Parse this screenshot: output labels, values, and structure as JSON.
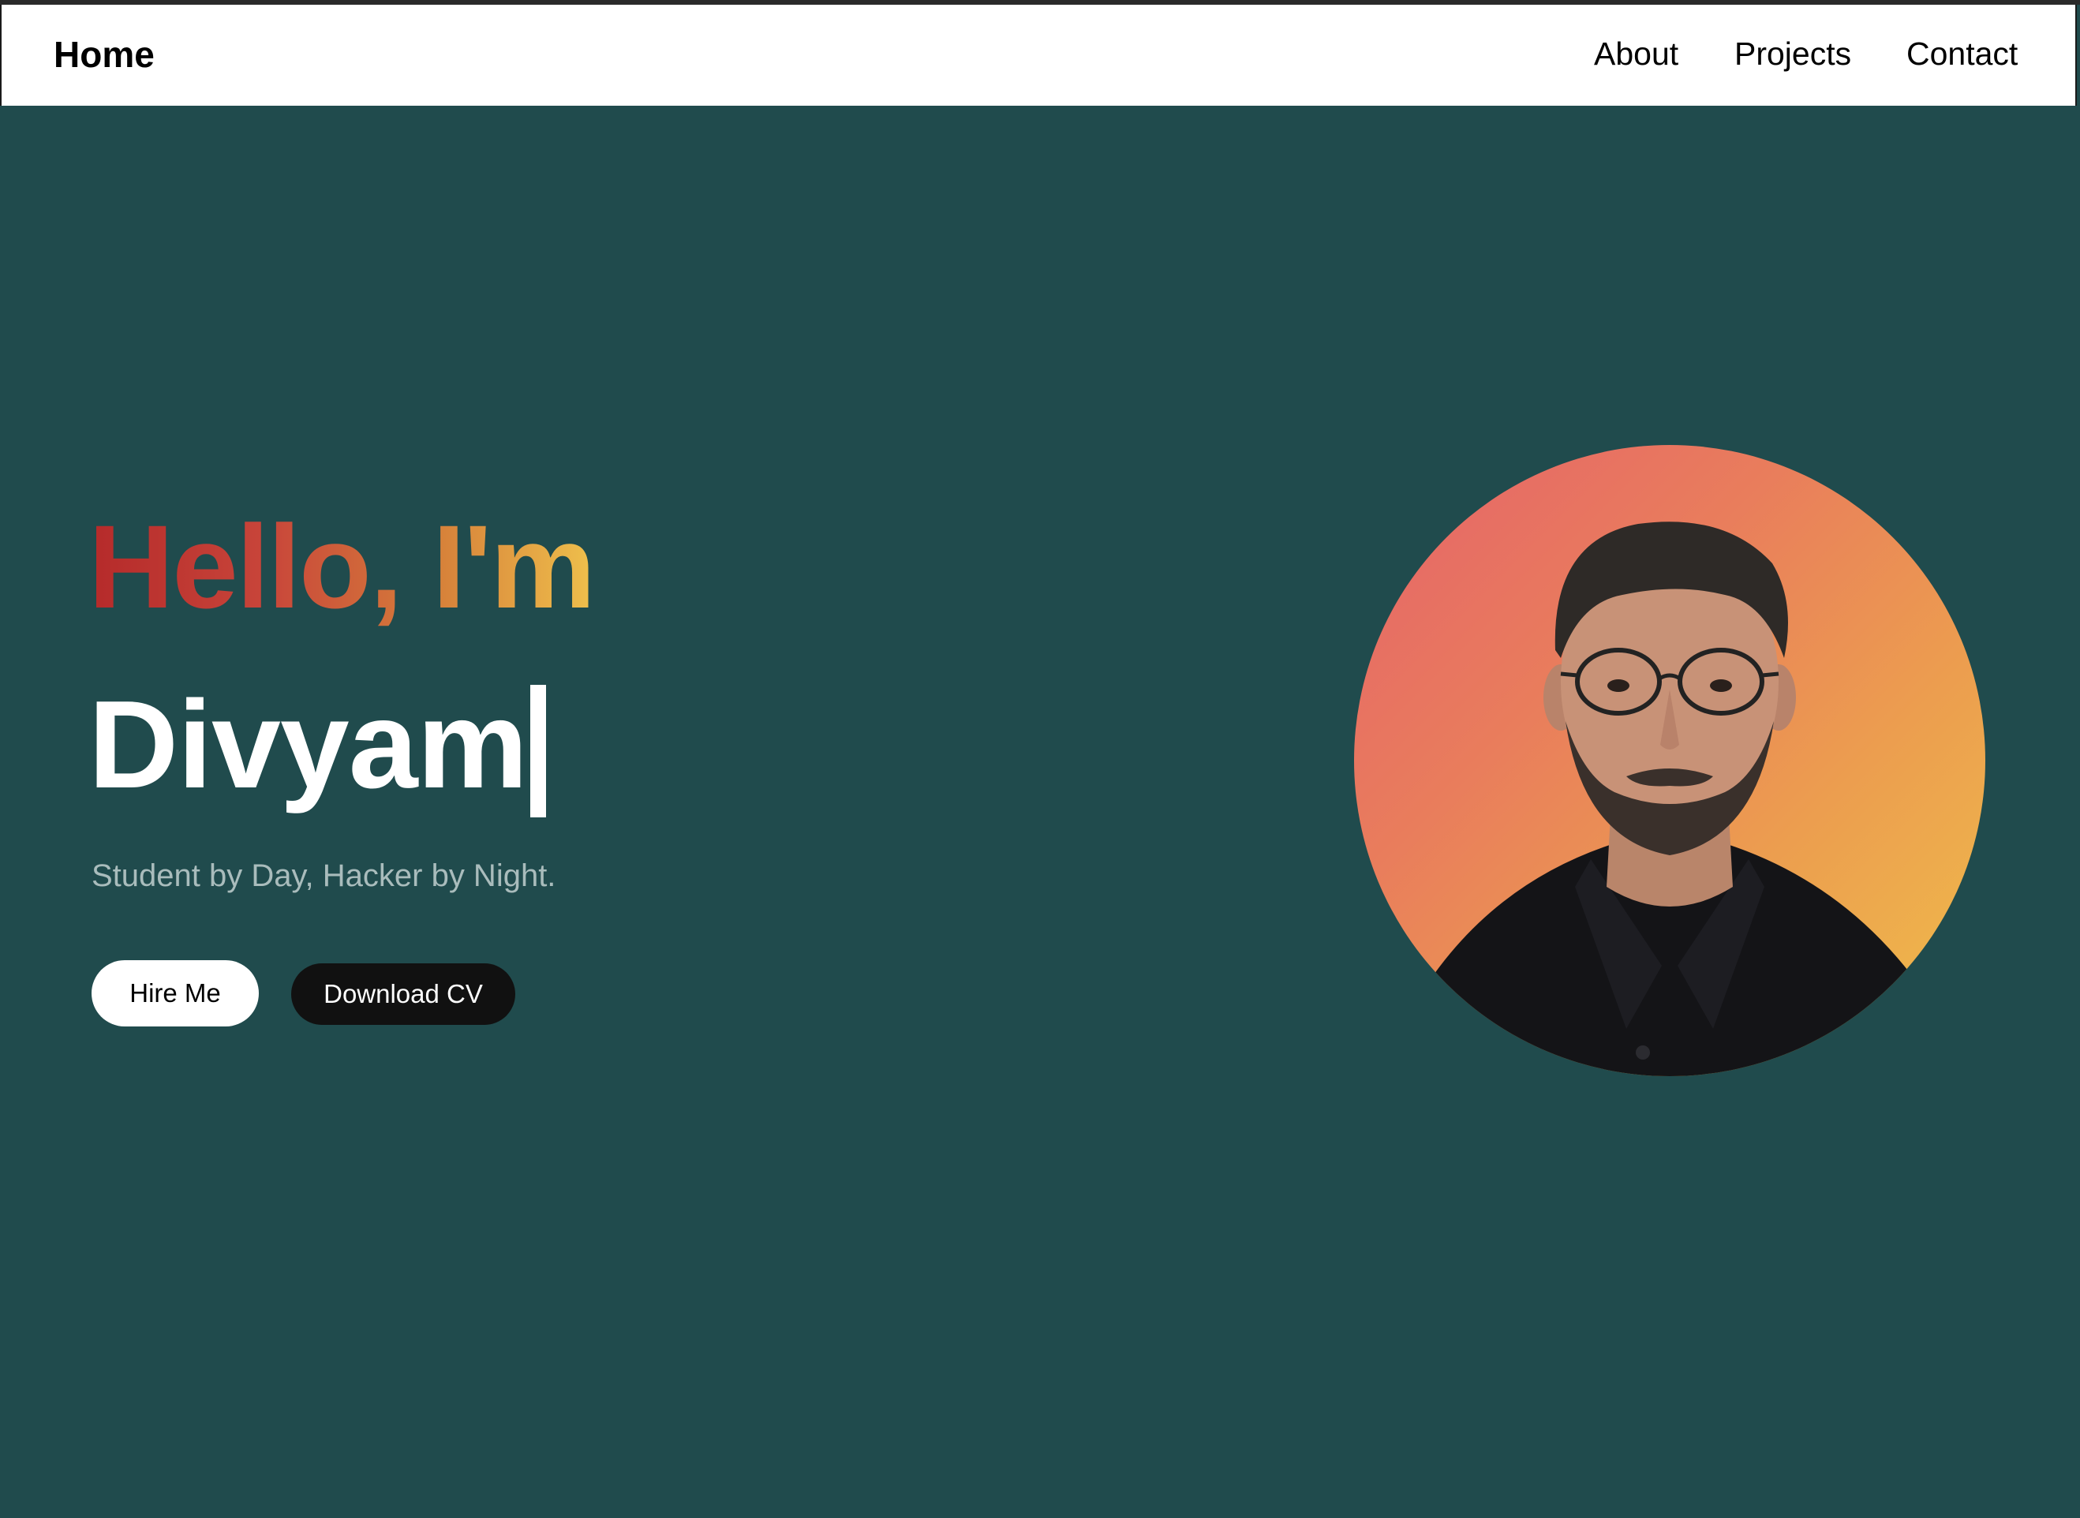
{
  "nav": {
    "brand": "Home",
    "links": [
      {
        "label": "About"
      },
      {
        "label": "Projects"
      },
      {
        "label": "Contact"
      }
    ]
  },
  "hero": {
    "greeting": "Hello, I'm",
    "name": "Divyam",
    "tagline": "Student by Day, Hacker by Night.",
    "hire_label": "Hire Me",
    "cv_label": "Download CV"
  },
  "colors": {
    "background": "#204b4d",
    "navbar": "#ffffff",
    "greeting_gradient": [
      "#b52a2a",
      "#efc04c"
    ],
    "avatar_gradient": [
      "#e5636a",
      "#efbf4a"
    ],
    "cv_button": "#111111"
  }
}
